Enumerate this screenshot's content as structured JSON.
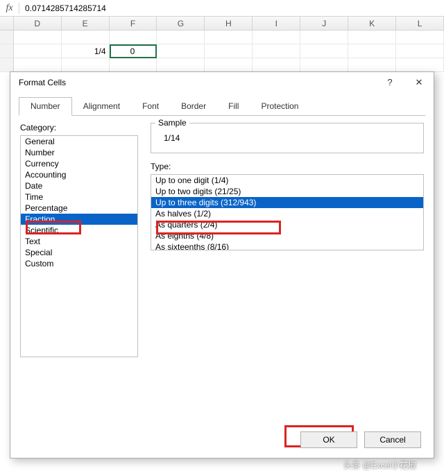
{
  "formula_bar": {
    "fx_label": "fx",
    "value": "0.0714285714285714"
  },
  "columns": [
    "D",
    "E",
    "F",
    "G",
    "H",
    "I",
    "J",
    "K",
    "L"
  ],
  "row": {
    "e_value": "1/4",
    "f_value": "0"
  },
  "dialog": {
    "title": "Format Cells",
    "help_icon": "?",
    "close_icon": "✕",
    "tabs": [
      "Number",
      "Alignment",
      "Font",
      "Border",
      "Fill",
      "Protection"
    ],
    "active_tab": 0,
    "category_label": "Category:",
    "categories": [
      "General",
      "Number",
      "Currency",
      "Accounting",
      "Date",
      "Time",
      "Percentage",
      "Fraction",
      "Scientific",
      "Text",
      "Special",
      "Custom"
    ],
    "category_selected": 7,
    "sample_label": "Sample",
    "sample_value": "1/14",
    "type_label": "Type:",
    "types": [
      "Up to one digit (1/4)",
      "Up to two digits (21/25)",
      "Up to three digits (312/943)",
      "As halves (1/2)",
      "As quarters (2/4)",
      "As eighths (4/8)",
      "As sixteenths (8/16)"
    ],
    "type_selected": 2,
    "ok": "OK",
    "cancel": "Cancel"
  },
  "watermark": "头条 @Excel小花椒"
}
